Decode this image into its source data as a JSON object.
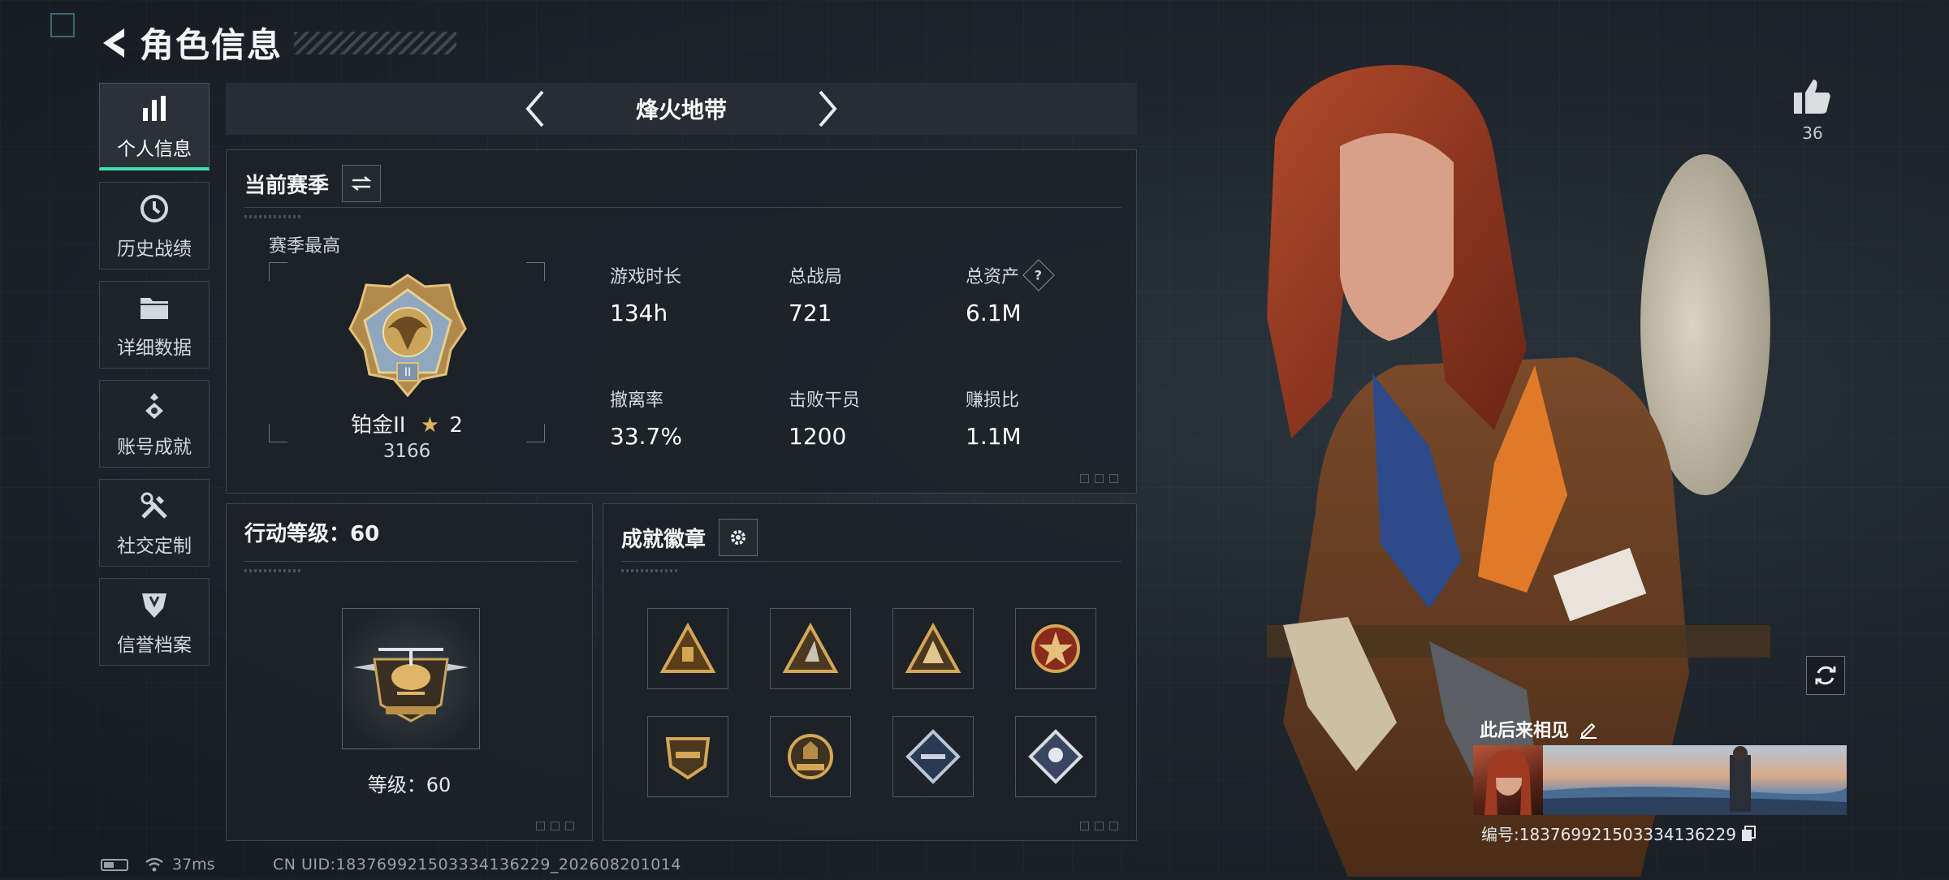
{
  "header": {
    "title": "角色信息"
  },
  "sidebar": {
    "items": [
      {
        "label": "个人信息",
        "icon": "bar-chart-icon",
        "active": true
      },
      {
        "label": "历史战绩",
        "icon": "history-clock-icon"
      },
      {
        "label": "详细数据",
        "icon": "folder-icon"
      },
      {
        "label": "账号成就",
        "icon": "achievement-emblem-icon"
      },
      {
        "label": "社交定制",
        "icon": "tools-icon"
      },
      {
        "label": "信誉档案",
        "icon": "credit-shield-icon"
      }
    ]
  },
  "mode": {
    "title": "烽火地带"
  },
  "season": {
    "title": "当前赛季",
    "best_label": "赛季最高",
    "rank_name": "铂金II",
    "rank_stars": "2",
    "rank_score": "3166",
    "stats": [
      {
        "label": "游戏时长",
        "value": "134h"
      },
      {
        "label": "总战局",
        "value": "721"
      },
      {
        "label": "总资产",
        "value": "6.1M",
        "help": "?"
      },
      {
        "label": "撤离率",
        "value": "33.7%"
      },
      {
        "label": "击败干员",
        "value": "1200"
      },
      {
        "label": "赚损比",
        "value": "1.1M"
      }
    ]
  },
  "action_level": {
    "title": "行动等级：60",
    "level_text": "等级：60"
  },
  "badges": {
    "title": "成就徽章"
  },
  "profile": {
    "likes": "36",
    "card_name": "此后来相见",
    "id_text": "编号:18376992150333413622​9"
  },
  "status": {
    "ping": "37ms",
    "uid": "CN UID:18376992150333413622​9_202608201014"
  },
  "colors": {
    "accent": "#3fe0b0",
    "gold": "#c9a45a"
  }
}
